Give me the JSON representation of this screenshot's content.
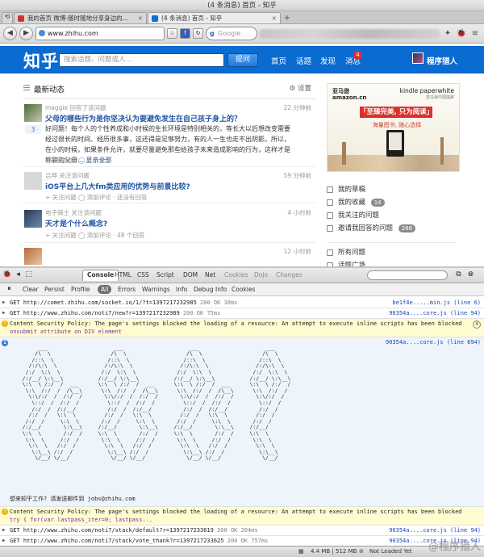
{
  "window": {
    "title": "(4 条消息) 首页 - 知乎"
  },
  "tabs": [
    {
      "label": "我的首页 微博-随时随地分享身边的...",
      "active": false
    },
    {
      "label": "(4 条消息) 首页 - 知乎",
      "active": true
    }
  ],
  "toolbar": {
    "back": "◀",
    "forward": "▶",
    "url": "www.zhihu.com",
    "search_engine": "g",
    "search_placeholder": "Google"
  },
  "zhihu": {
    "logo": "知乎",
    "search_placeholder": "搜索话题、问题或人...",
    "ask_button": "提问",
    "nav": [
      "首页",
      "话题",
      "发现",
      "消息"
    ],
    "message_badge": "4",
    "username": "程序猎人",
    "brand_color": "#0a6bd1"
  },
  "feed": {
    "title": "最新动态",
    "settings": "⚙ 设置",
    "items": [
      {
        "meta": "maggie 回答了该问题",
        "time": "22 分钟前",
        "question": "父母的哪些行为是你坚决认为要避免发生在自己孩子身上的？",
        "votes": "3",
        "body": "好问题！每个人的个性养成和小时候的生长环境是特别相关的，等长大以后想改变需要经过很长的时间、经历很多事，这还得是足够努力，有的人一生也走不出阴影。所以，在小的时候，如果条件允许，就要尽量避免那些给孩子未来造成影响的行为，这样才是称职的父母…",
        "more": "显示全部",
        "actions": "+ 关注问题    ◯ 4 条评论"
      },
      {
        "meta": "吕坤 关注该问题",
        "time": "59 分钟前",
        "question": "iOS平台上几大fm类应用的优势与前景比较?",
        "actions": "+ 关注问题  ◯ 添加评论 · 还没有回答"
      },
      {
        "meta": "电子骑士 关注该问题",
        "time": "4 小时前",
        "question": "天才是个什么概念?",
        "actions": "+ 关注问题  ◯ 添加评论 · 48 个回答"
      },
      {
        "meta": "",
        "time": "12 小时前",
        "question": "",
        "actions": ""
      }
    ]
  },
  "ad": {
    "logo_line1": "亚马逊",
    "logo_line2": "amazon.cn",
    "kindle": "kindle paperwhite",
    "kindle_sub": "亚马逊中国独家",
    "slogan": "「至臻完美, 只为阅读」",
    "sub": "海量图书, 随心选择"
  },
  "sidebar": {
    "items": [
      {
        "label": "我的草稿",
        "count": ""
      },
      {
        "label": "我的收藏",
        "count": "14"
      },
      {
        "label": "我关注的问题",
        "count": ""
      },
      {
        "label": "邀请我回答的问题",
        "count": "288"
      },
      {
        "label": "所有问题",
        "count": ""
      },
      {
        "label": "话题广场",
        "count": ""
      }
    ]
  },
  "firebug": {
    "tabs": [
      "Console",
      "HTML",
      "CSS",
      "Script",
      "DOM",
      "Net",
      "Cookies",
      "Dojo",
      "Changes"
    ],
    "tools": [
      "Clear",
      "Persist",
      "Profile",
      "All",
      "Errors",
      "Warnings",
      "Info",
      "Debug Info",
      "Cookies"
    ],
    "rows": [
      {
        "type": "get",
        "text": "GET http://comet.zhihu.com/socket.io/1/?t=1397217232985",
        "status": "200 OK 38ms",
        "src": "be1f4e.....min.js (line 6)"
      },
      {
        "type": "get",
        "text": "GET http://www.zhihu.com/noti7/new?r=1397217232989",
        "status": "200 OK 75ms",
        "src": "90354a....core.js (line 94)"
      },
      {
        "type": "warn",
        "text": "Content Security Policy: The page's settings blocked the loading of a resource: An attempt to execute inline scripts has been blocked",
        "text2": "onsubmit attribute on DIV element",
        "num": "4"
      },
      {
        "type": "info",
        "src": "90354a....core.js (line 694)",
        "recruit": "想来知乎工作? 请发送邮件到 jobs@zhihu.com"
      },
      {
        "type": "warn",
        "text": "Content Security Policy: The page's settings blocked the loading of a resource: An attempt to execute inline scripts has been blocked",
        "text2": "try {  for(var lastpass_iter=0; lastpass..."
      },
      {
        "type": "get",
        "text": "GET http://www.zhihu.com/noti7/stack/default?r=1397217233619",
        "status": "200 OK 204ms",
        "src": "90354a....core.js (line 94)"
      },
      {
        "type": "get",
        "text": "GET http://www.zhihu.com/noti7/stack/vote_thank?r=1397217233625",
        "status": "200 OK 757ms",
        "src": "90354a....core.js (line 94)"
      }
    ],
    "cmd": ">>>"
  },
  "statusbar": {
    "memory": "4.4 MB | 512 MB",
    "state": "Not Loaded Yet",
    "watermark": "@程序猎人"
  }
}
